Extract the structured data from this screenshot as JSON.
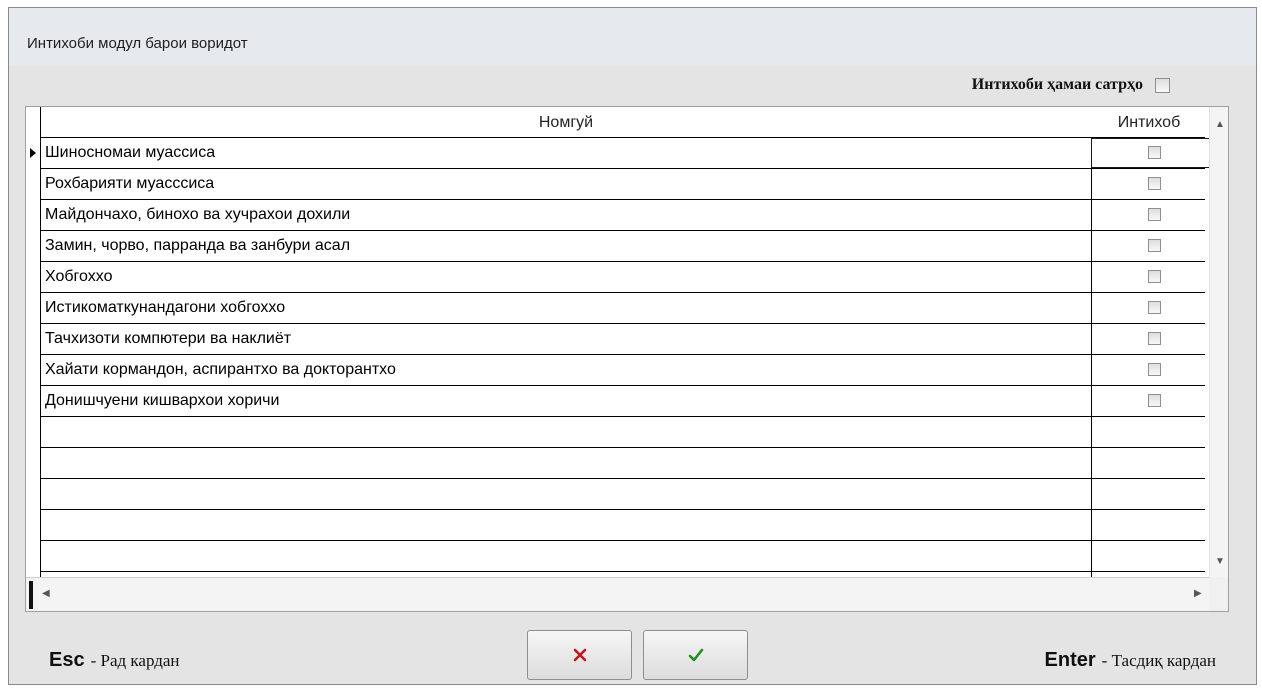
{
  "window": {
    "title": "Интихоби модул барои воридот"
  },
  "select_all": {
    "label": "Интихоби ҳамаи сатрҳо",
    "checked": false
  },
  "grid": {
    "columns": [
      "Номгуй",
      "Интихоб"
    ],
    "rows": [
      {
        "name": "Шиносномаи муассиса",
        "selected": false
      },
      {
        "name": "Рохбарияти муасссиса",
        "selected": false
      },
      {
        "name": "Майдончахо, бинохо ва хучрахои дохили",
        "selected": false
      },
      {
        "name": "Замин, чорво, парранда ва занбури асал",
        "selected": false
      },
      {
        "name": "Хобгоххо",
        "selected": false
      },
      {
        "name": "Истикоматкунандагони хобгоххо",
        "selected": false
      },
      {
        "name": "Тачхизоти компютери ва наклиёт",
        "selected": false
      },
      {
        "name": "Хайати кормандон, аспирантхо ва докторантхо",
        "selected": false
      },
      {
        "name": "Донишчуени кишвархои хоричи",
        "selected": false
      }
    ]
  },
  "footer": {
    "esc_key": "Esc",
    "esc_action": "- Рад кардан",
    "enter_key": "Enter",
    "enter_action": "- Тасдиқ кардан",
    "cancel_icon": "x-icon",
    "confirm_icon": "check-icon",
    "cancel_color": "#c0161c",
    "confirm_color": "#1f8f1f"
  }
}
